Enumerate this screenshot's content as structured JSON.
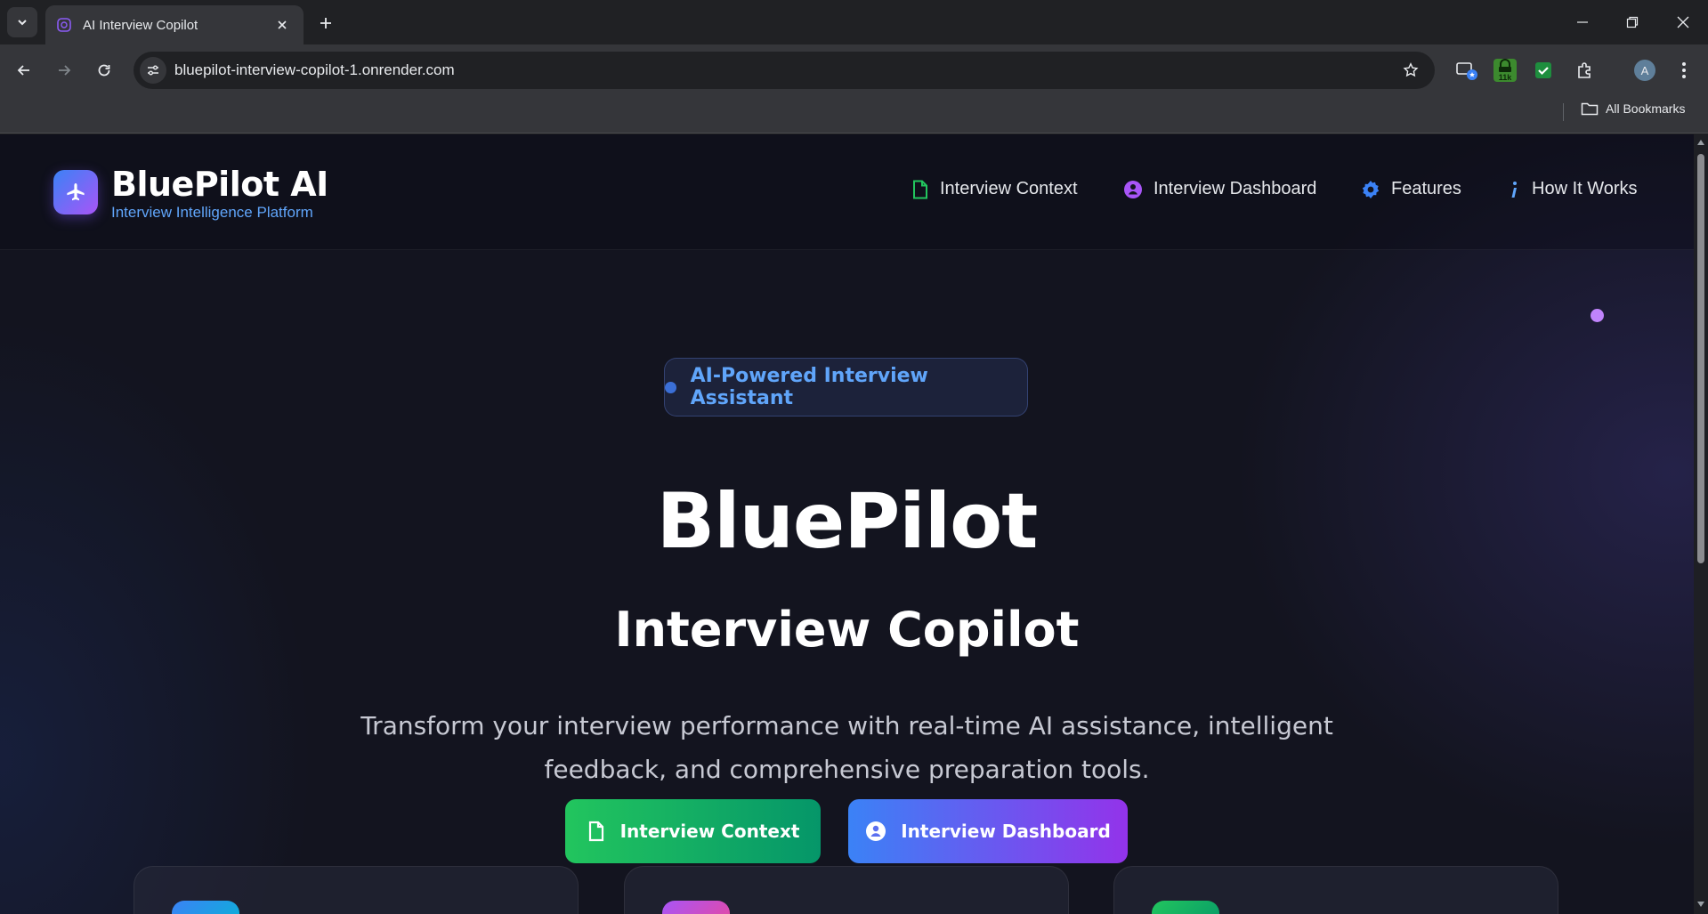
{
  "browser": {
    "tab_title": "AI Interview Copilot",
    "url": "bluepilot-interview-copilot-1.onrender.com",
    "bookmarks_label": "All Bookmarks",
    "profile_initial": "A",
    "extension_badge": "11k"
  },
  "header": {
    "brand": "BluePilot AI",
    "tagline": "Interview Intelligence Platform",
    "nav": [
      {
        "label": "Interview Context",
        "icon": "file-icon",
        "color": "#22c55e"
      },
      {
        "label": "Interview Dashboard",
        "icon": "user-circle-icon",
        "color": "#a855f7"
      },
      {
        "label": "Features",
        "icon": "gear-icon",
        "color": "#3b82f6"
      },
      {
        "label": "How It Works",
        "icon": "info-icon",
        "color": "#60a5fa"
      }
    ]
  },
  "hero": {
    "badge": "AI-Powered Interview Assistant",
    "title": "BluePilot",
    "subtitle": "Interview Copilot",
    "description": "Transform your interview performance with real-time AI assistance, intelligent feedback, and comprehensive preparation tools.",
    "cta_primary": "Interview Context",
    "cta_secondary": "Interview Dashboard"
  },
  "colors": {
    "accent_blue": "#3b82f6",
    "accent_purple": "#a855f7",
    "accent_green": "#22c55e",
    "page_bg": "#13141f"
  }
}
